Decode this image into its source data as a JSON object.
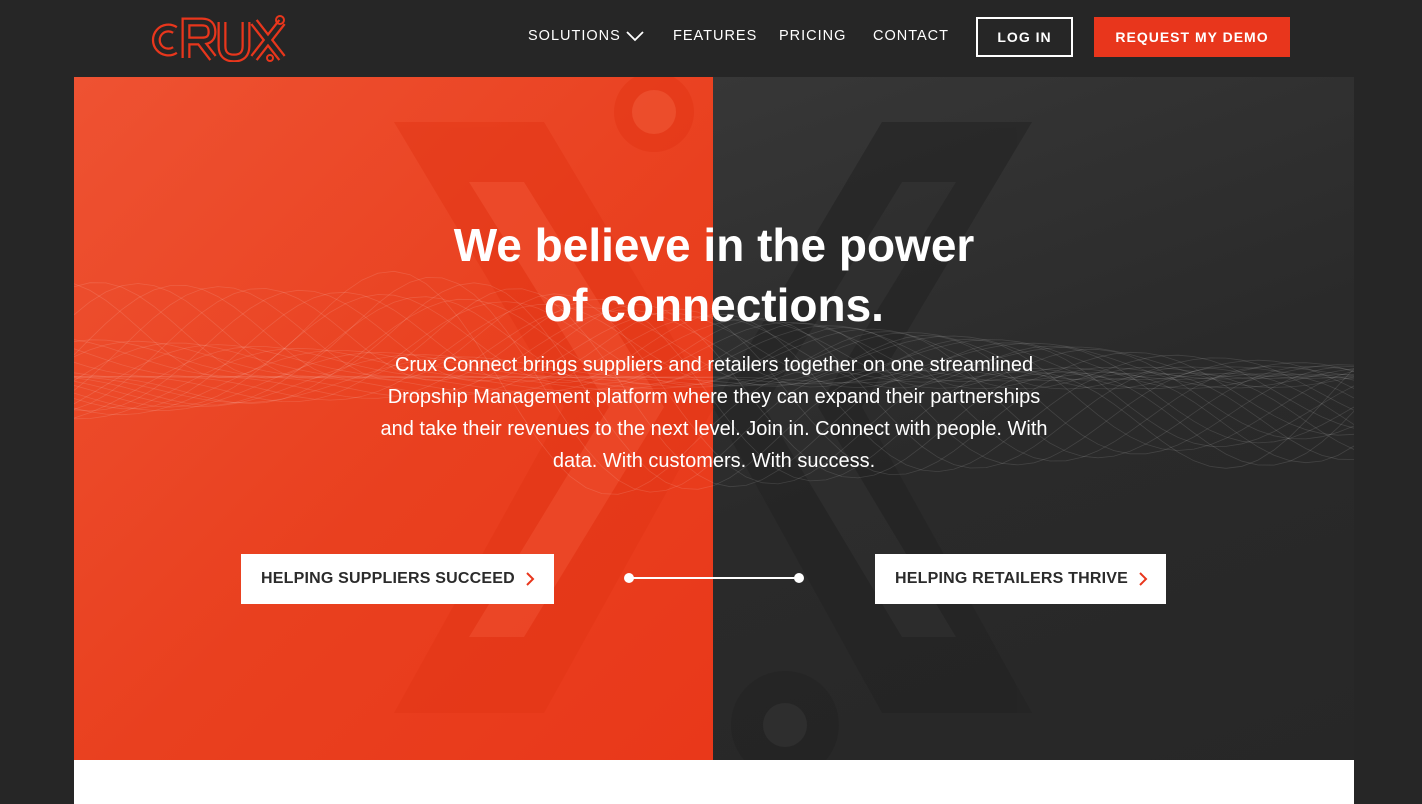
{
  "brand": {
    "logo_text": "CRUX",
    "accent_color": "#e8361c"
  },
  "nav": {
    "items": [
      {
        "label": "SOLUTIONS",
        "has_dropdown": true,
        "icon": "chevron-down-icon"
      },
      {
        "label": "FEATURES"
      },
      {
        "label": "PRICING"
      },
      {
        "label": "CONTACT"
      }
    ],
    "login_label": "LOG IN",
    "demo_label": "REQUEST MY DEMO"
  },
  "hero": {
    "headline_line1": "We believe in the power",
    "headline_line2": "of connections.",
    "subtext": "Crux Connect brings suppliers and retailers together on one streamlined Dropship Management platform where they can expand their partnerships and take their revenues to the next level. Join in. Connect with people. With data. With customers. With success.",
    "cta_suppliers": "HELPING SUPPLIERS SUCCEED",
    "cta_retailers": "HELPING RETAILERS THRIVE",
    "left_color": "#e9401f",
    "right_color": "#2e2e2e"
  }
}
